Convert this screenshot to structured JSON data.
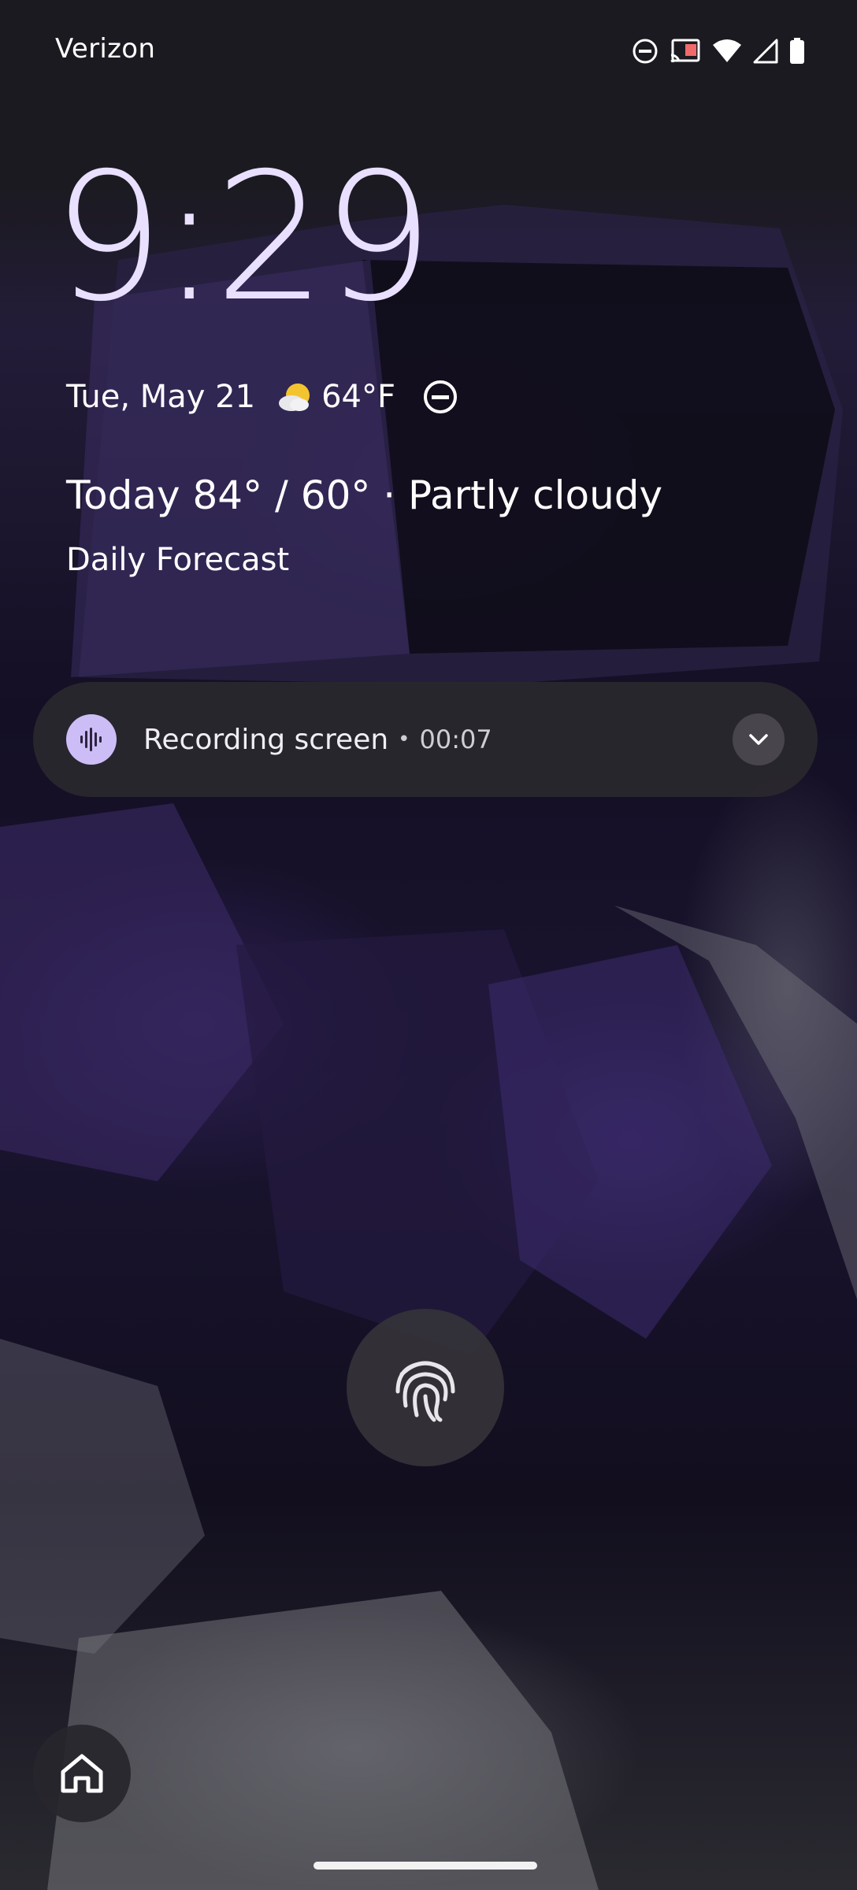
{
  "status_bar": {
    "carrier": "Verizon",
    "icons": [
      "do-not-disturb-icon",
      "cast-icon",
      "wifi-icon",
      "cell-signal-icon",
      "battery-icon"
    ]
  },
  "lock_screen": {
    "time": "9:29",
    "date": "Tue, May 21",
    "temperature": "64°F",
    "weather_icon": "partly-cloudy-icon",
    "forecast": "Today 84° / 60° · Partly cloudy",
    "forecast_link": "Daily Forecast"
  },
  "notification": {
    "title": "Recording screen",
    "separator": "•",
    "elapsed": "00:07",
    "icon": "audio-waveform-icon",
    "accent": "#cdbdf7"
  },
  "shortcuts": {
    "fingerprint": "fingerprint-icon",
    "home": "home-icon"
  }
}
